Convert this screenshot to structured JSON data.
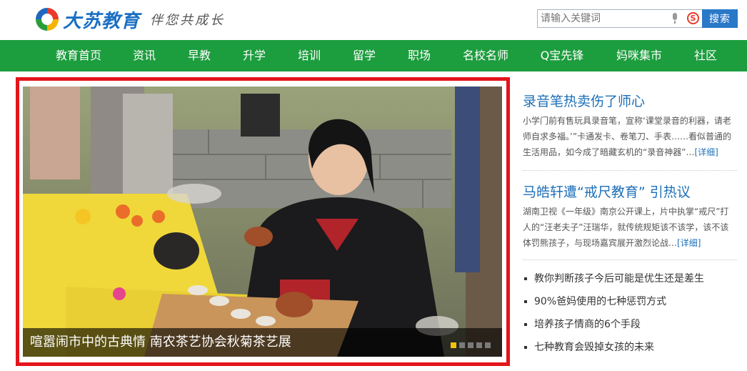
{
  "header": {
    "logo_name": "大苏教育",
    "slogan": "伴您共成长",
    "search": {
      "placeholder": "请输入关键词",
      "button_label": "搜索"
    }
  },
  "nav": {
    "items": [
      "教育首页",
      "资讯",
      "早教",
      "升学",
      "培训",
      "留学",
      "职场",
      "名校名师",
      "Q宝先锋",
      "妈咪集市",
      "社区"
    ]
  },
  "slideshow": {
    "caption": "喧嚣闹市中的古典情 南农茶艺协会秋菊茶艺展",
    "slide_count": 5,
    "active_slide": 1
  },
  "featured": [
    {
      "title": "录音笔热卖伤了师心",
      "summary": "小学门前有售玩具录音笔，宣称‘课堂录音的利器，请老师自求多福。’”卡通发卡、卷笔刀、手表……看似普通的生活用品，如今成了暗藏玄机的“录音神器”…",
      "link_label": "[详细]"
    },
    {
      "title": "马皓轩遭“戒尺教育” 引热议",
      "summary": "湖南卫视《一年级》南京公开课上，片中执掌“戒尺”打人的“汪老夫子”汪瑞华，就传统规矩该不该学，该不该体罚熊孩子，与现场嘉宾展开激烈论战…",
      "link_label": "[详细]"
    }
  ],
  "news_list": [
    "教你判断孩子今后可能是优生还是差生",
    "90%爸妈使用的七种惩罚方式",
    "培养孩子情商的6个手段",
    "七种教育会毁掉女孩的未来"
  ],
  "colors": {
    "brand_blue": "#1a6fc4",
    "nav_green": "#1c9d3e",
    "highlight_red": "#e3151b",
    "link_blue": "#1d6fb8",
    "active_dot": "#f2c20a"
  }
}
